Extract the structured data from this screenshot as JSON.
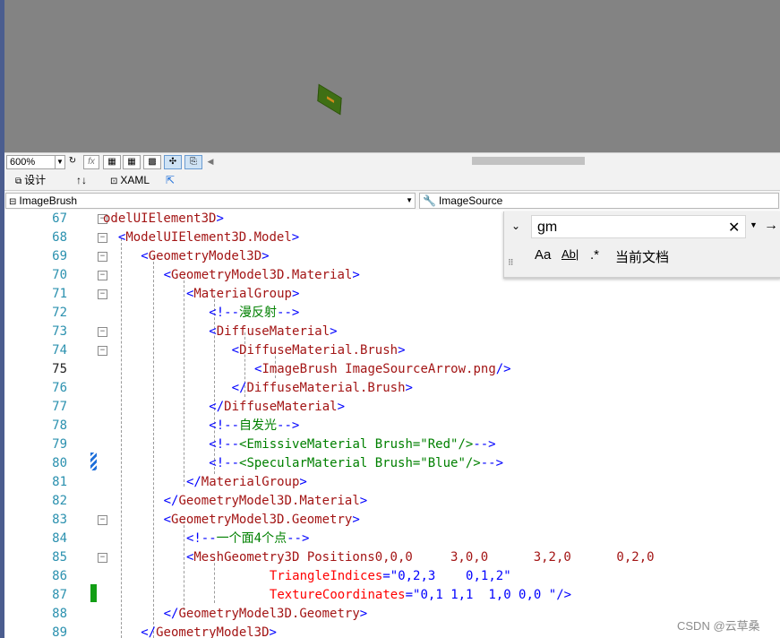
{
  "designer": {
    "object": "green-textured-plane"
  },
  "zoom": {
    "value": "600%",
    "fx_label": "fx"
  },
  "tabs": {
    "design": "设计",
    "swap": "↑↓",
    "xaml": "XAML"
  },
  "nav": {
    "left": "ImageBrush",
    "right": "ImageSource"
  },
  "find": {
    "query": "gm",
    "scope": "当前文档",
    "match_case": "Aa",
    "whole_word": "Ab|"
  },
  "editor": {
    "current_line": 75,
    "lines": [
      {
        "n": "67",
        "t": "odelUIElement3D>"
      },
      {
        "n": "68",
        "t": "<ModelUIElement3D.Model>"
      },
      {
        "n": "69",
        "t": "<GeometryModel3D>"
      },
      {
        "n": "70",
        "t": "<GeometryModel3D.Material>"
      },
      {
        "n": "71",
        "t": "<MaterialGroup>"
      },
      {
        "n": "72",
        "t": "<!--漫反射-->"
      },
      {
        "n": "73",
        "t": "<DiffuseMaterial>"
      },
      {
        "n": "74",
        "t": "<DiffuseMaterial.Brush>"
      },
      {
        "n": "75",
        "t": "<ImageBrush ImageSource=\"Arrow.png\"/>"
      },
      {
        "n": "76",
        "t": "</DiffuseMaterial.Brush>"
      },
      {
        "n": "77",
        "t": "</DiffuseMaterial>"
      },
      {
        "n": "78",
        "t": "<!--自发光-->"
      },
      {
        "n": "79",
        "t": "<!--<EmissiveMaterial Brush=\"Red\"/>-->"
      },
      {
        "n": "80",
        "t": "<!--<SpecularMaterial Brush=\"Blue\"/>-->"
      },
      {
        "n": "81",
        "t": "</MaterialGroup>"
      },
      {
        "n": "82",
        "t": "</GeometryModel3D.Material>"
      },
      {
        "n": "83",
        "t": "<GeometryModel3D.Geometry>"
      },
      {
        "n": "84",
        "t": "<!--一个面4个点-->"
      },
      {
        "n": "85",
        "t": "<MeshGeometry3D Positions=\"0,0,0     3,0,0      3,2,0      0,2,0\""
      },
      {
        "n": "86",
        "t": "TriangleIndices=\"0,2,3    0,1,2\""
      },
      {
        "n": "87",
        "t": "TextureCoordinates=\"0,1 1,1  1,0 0,0 \"/>"
      },
      {
        "n": "88",
        "t": "</GeometryModel3D.Geometry>"
      },
      {
        "n": "89",
        "t": "</GeometryModel3D>"
      }
    ]
  },
  "watermark": "CSDN @云草桑"
}
